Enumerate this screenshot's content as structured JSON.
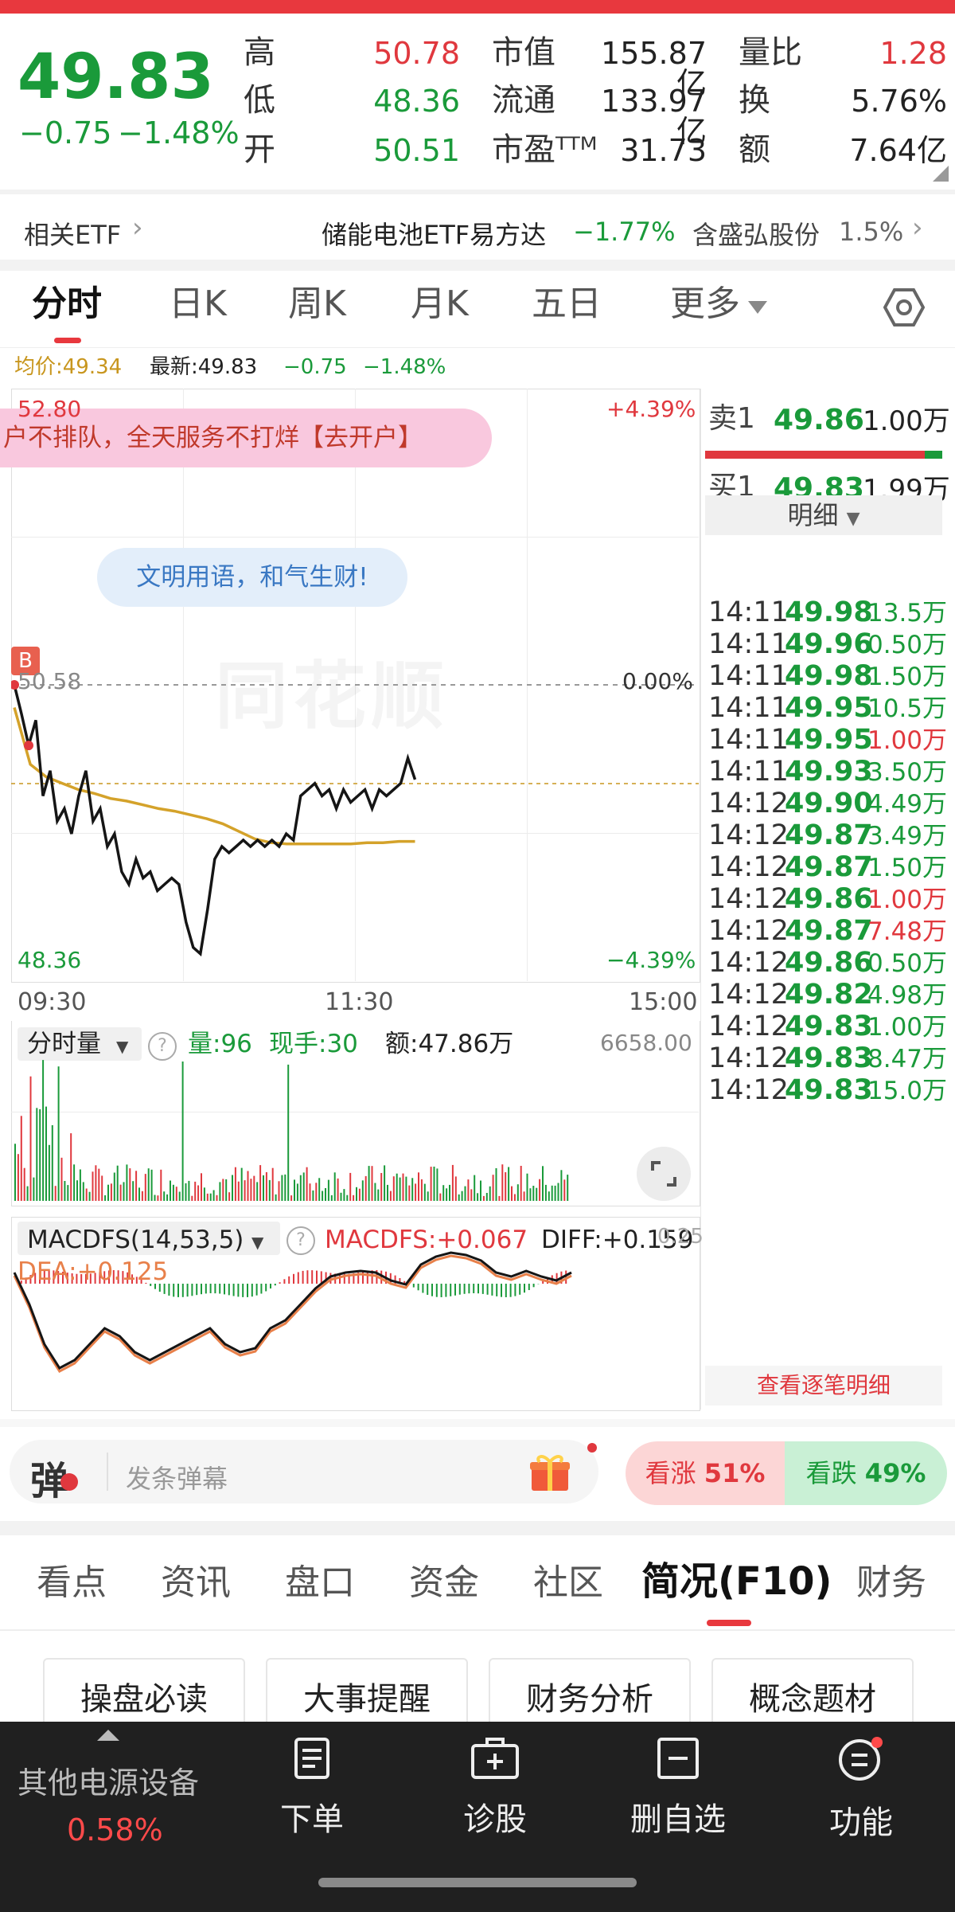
{
  "quote": {
    "price": "49.83",
    "change": "−0.75",
    "change_pct": "−1.48%",
    "stats": [
      {
        "label": "高",
        "value": "50.78",
        "color": "#e0383e"
      },
      {
        "label": "低",
        "value": "48.36",
        "color": "#1a9a3a"
      },
      {
        "label": "开",
        "value": "50.51",
        "color": "#1a9a3a"
      }
    ],
    "stats2": [
      {
        "label": "市值",
        "value": "155.87亿"
      },
      {
        "label": "流通",
        "value": "133.97亿"
      },
      {
        "label": "市盈ᵀᵀᴹ",
        "value": "31.73"
      }
    ],
    "stats3": [
      {
        "label": "量比",
        "value": "1.28",
        "color": "#e0383e"
      },
      {
        "label": "换",
        "value": "5.76%",
        "color": "#222222"
      },
      {
        "label": "额",
        "value": "7.64亿",
        "color": "#222222"
      }
    ]
  },
  "etf": {
    "label": "相关ETF",
    "name": "储能电池ETF易方达",
    "name_pct": "−1.77%",
    "holding": "含盛弘股份",
    "holding_pct": "1.5%"
  },
  "chart_tabs": [
    "分时",
    "日K",
    "周K",
    "月K",
    "五日",
    "更多"
  ],
  "avg_row": {
    "avg": "均价:49.34",
    "latest": "最新:49.83",
    "chg": "−0.75",
    "pct": "−1.48%"
  },
  "intraday": {
    "ymax": "52.80",
    "ymax_pct": "+4.39%",
    "yref": "50.58",
    "yref_pct": "0.00%",
    "ymin": "48.36",
    "ymin_pct": "−4.39%",
    "times": [
      "09:30",
      "11:30",
      "15:00"
    ],
    "ad_text": "户不排队，全天服务不打烊【去开户】",
    "slogan": "文明用语，和气生财!",
    "b_mark": "B",
    "watermark": "同花顺"
  },
  "chart_data": {
    "type": "line",
    "x_labels": [
      "09:30",
      "11:30",
      "15:00"
    ],
    "ylim": [
      48.36,
      52.8
    ],
    "series": [
      {
        "values": [
          50.58,
          50.35,
          50.1,
          50.3,
          49.7,
          49.9,
          49.5,
          49.6,
          49.4,
          49.7,
          49.9,
          49.5,
          49.6,
          49.3,
          49.4,
          49.1,
          49.0,
          49.2,
          49.05,
          49.1,
          48.95,
          49.0,
          49.05,
          49.0,
          48.7,
          48.5,
          48.45,
          48.8,
          49.2,
          49.3,
          49.25,
          49.3,
          49.35,
          49.3,
          49.35,
          49.3,
          49.35,
          49.3,
          49.4,
          49.35,
          49.7,
          49.75,
          49.8,
          49.7,
          49.75,
          49.6,
          49.75,
          49.65,
          49.7,
          49.75,
          49.6,
          49.75,
          49.7,
          49.75,
          49.8,
          50.0,
          49.83
        ]
      },
      {
        "values": [
          50.4,
          49.95,
          49.85,
          49.8,
          49.75,
          49.72,
          49.68,
          49.66,
          49.63,
          49.6,
          49.58,
          49.55,
          49.52,
          49.48,
          49.42,
          49.36,
          49.33,
          49.32,
          49.32,
          49.32,
          49.32,
          49.32,
          49.33,
          49.33,
          49.34,
          49.34
        ]
      }
    ]
  },
  "order_book": {
    "sell": {
      "label": "卖1",
      "price": "49.86",
      "vol": "1.00万"
    },
    "buy": {
      "label": "买1",
      "price": "49.83",
      "vol": "1.99万"
    },
    "detail_btn": "明细",
    "ticks": [
      {
        "t": "14:11",
        "p": "49.98",
        "v": "13.5万",
        "c": "#1a9a3a"
      },
      {
        "t": "14:11",
        "p": "49.96",
        "v": "0.50万",
        "c": "#1a9a3a"
      },
      {
        "t": "14:11",
        "p": "49.98",
        "v": "1.50万",
        "c": "#1a9a3a"
      },
      {
        "t": "14:11",
        "p": "49.95",
        "v": "10.5万",
        "c": "#1a9a3a"
      },
      {
        "t": "14:11",
        "p": "49.95",
        "v": "1.00万",
        "c": "#e0383e"
      },
      {
        "t": "14:11",
        "p": "49.93",
        "v": "3.50万",
        "c": "#1a9a3a"
      },
      {
        "t": "14:12",
        "p": "49.90",
        "v": "4.49万",
        "c": "#1a9a3a"
      },
      {
        "t": "14:12",
        "p": "49.87",
        "v": "3.49万",
        "c": "#1a9a3a"
      },
      {
        "t": "14:12",
        "p": "49.87",
        "v": "1.50万",
        "c": "#1a9a3a"
      },
      {
        "t": "14:12",
        "p": "49.86",
        "v": "1.00万",
        "c": "#e0383e"
      },
      {
        "t": "14:12",
        "p": "49.87",
        "v": "7.48万",
        "c": "#e0383e"
      },
      {
        "t": "14:12",
        "p": "49.86",
        "v": "0.50万",
        "c": "#1a9a3a"
      },
      {
        "t": "14:12",
        "p": "49.82",
        "v": "4.98万",
        "c": "#1a9a3a"
      },
      {
        "t": "14:12",
        "p": "49.83",
        "v": "1.00万",
        "c": "#1a9a3a"
      },
      {
        "t": "14:12",
        "p": "49.83",
        "v": "8.47万",
        "c": "#1a9a3a"
      },
      {
        "t": "14:12",
        "p": "49.83",
        "v": "15.0万",
        "c": "#1a9a3a"
      }
    ],
    "view_all": "查看逐笔明细"
  },
  "volume": {
    "selector": "分时量",
    "vol": "量:96",
    "hand": "现手:30",
    "amount": "额:47.86万",
    "max": "6658.00"
  },
  "macd": {
    "selector": "MACDFS(14,53,5)",
    "macdfs": "MACDFS:+0.067",
    "diff": "DIFF:+0.159",
    "dea": "DEA:+0.125",
    "scale": "0.25"
  },
  "danmu": {
    "icon": "弹",
    "placeholder": "发条弹幕",
    "up": "看涨",
    "up_pct": "51%",
    "down": "看跌",
    "down_pct": "49%"
  },
  "bottom_tabs": [
    "看点",
    "资讯",
    "盘口",
    "资金",
    "社区",
    "简况(F10)",
    "财务"
  ],
  "chips": [
    "操盘必读",
    "大事提醒",
    "财务分析",
    "概念题材"
  ],
  "nav": {
    "sector": "其他电源设备",
    "sector_pct": "0.58%",
    "items": [
      "下单",
      "诊股",
      "删自选",
      "功能"
    ]
  }
}
